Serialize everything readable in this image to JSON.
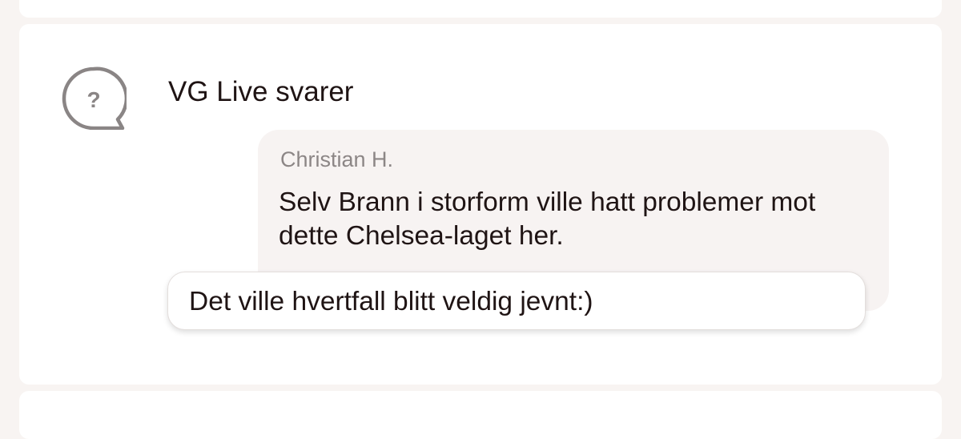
{
  "header": {
    "title": "VG Live svarer",
    "icon": "question-bubble-icon"
  },
  "question": {
    "author": "Christian H.",
    "text": "Selv Brann i storform ville hatt problemer mot dette Chelsea-laget her."
  },
  "answer": {
    "text": "Det ville hvertfall blitt veldig jevnt:)"
  },
  "icon_glyph": "?",
  "colors": {
    "page_background": "#f8f4f2",
    "card_background": "#ffffff",
    "question_background": "#f7f3f2",
    "text_primary": "#1f1414",
    "text_secondary": "#8c8686",
    "icon": "#8a8585"
  }
}
